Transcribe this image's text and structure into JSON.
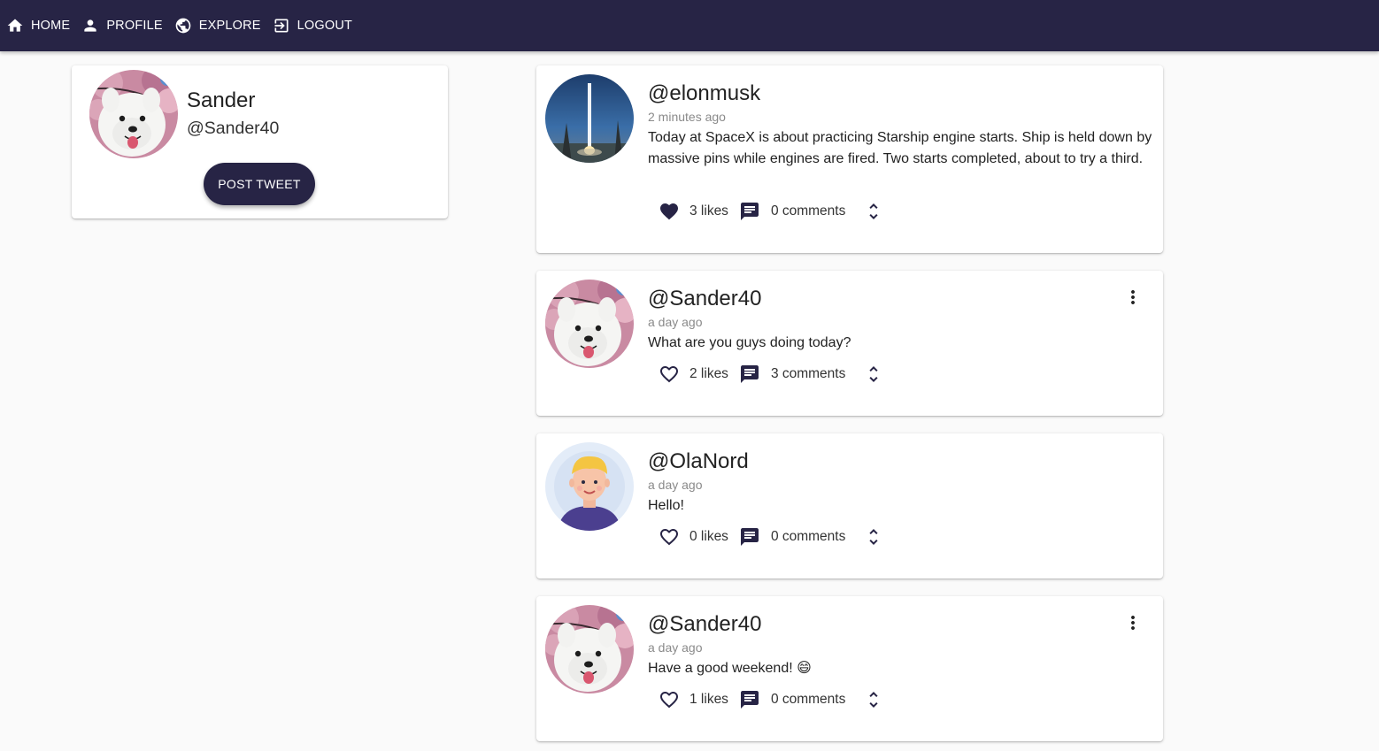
{
  "nav": {
    "home": "HOME",
    "profile": "PROFILE",
    "explore": "EXPLORE",
    "logout": "LOGOUT"
  },
  "profile": {
    "name": "Sander",
    "handle": "@Sander40",
    "post_button": "POST TWEET"
  },
  "tweets": [
    {
      "handle": "@elonmusk",
      "time": "2 minutes ago",
      "text": "Today at SpaceX is about practicing Starship engine starts. Ship is held down by massive pins while engines are fired. Two starts completed, about to try a third.",
      "likes": "3 likes",
      "comments": "0 comments",
      "liked": true,
      "avatar": "rocket-launch"
    },
    {
      "handle": "@Sander40",
      "time": "a day ago",
      "text": "What are you guys doing today?",
      "likes": "2 likes",
      "comments": "3 comments",
      "liked": false,
      "avatar": "samoyed-dog"
    },
    {
      "handle": "@OlaNord",
      "time": "a day ago",
      "text": "Hello!",
      "likes": "0 likes",
      "comments": "0 comments",
      "liked": false,
      "avatar": "cartoon-person"
    },
    {
      "handle": "@Sander40",
      "time": "a day ago",
      "text": "Have a good weekend! 😄",
      "likes": "1 likes",
      "comments": "0 comments",
      "liked": false,
      "avatar": "samoyed-dog"
    }
  ],
  "colors": {
    "appbar": "#272445",
    "accent": "#272445",
    "background": "#fafafa",
    "card": "#ffffff"
  }
}
